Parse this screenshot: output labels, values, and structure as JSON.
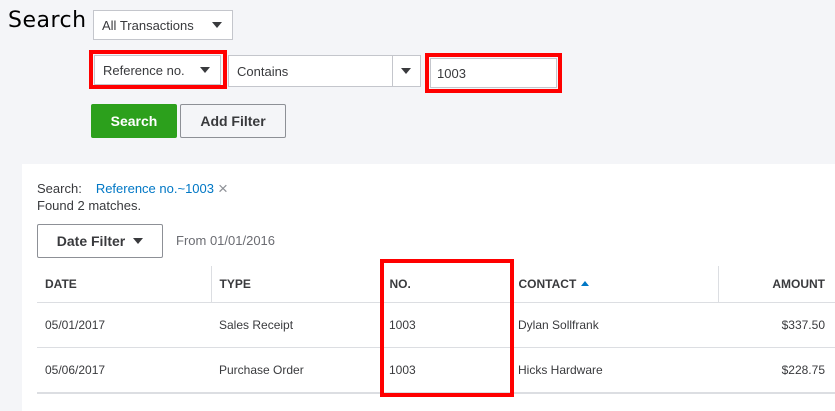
{
  "page": {
    "title": "Search"
  },
  "filters": {
    "transaction_type": "All Transactions",
    "field": "Reference no.",
    "condition": "Contains",
    "value": "1003"
  },
  "buttons": {
    "search": "Search",
    "add_filter": "Add Filter",
    "date_filter": "Date Filter"
  },
  "results": {
    "search_label": "Search:",
    "search_chip": "Reference no.~1003",
    "found": "Found 2 matches.",
    "date_range": "From 01/01/2016",
    "columns": {
      "date": "DATE",
      "type": "TYPE",
      "no": "NO.",
      "contact": "CONTACT",
      "amount": "AMOUNT"
    },
    "rows": [
      {
        "date": "05/01/2017",
        "type": "Sales Receipt",
        "no": "1003",
        "contact": "Dylan Sollfrank",
        "amount": "$337.50"
      },
      {
        "date": "05/06/2017",
        "type": "Purchase Order",
        "no": "1003",
        "contact": "Hicks Hardware",
        "amount": "$228.75"
      }
    ]
  },
  "colors": {
    "primary_green": "#2ca01c",
    "link_blue": "#0077c5",
    "highlight_red": "#ff0000"
  },
  "icons": {
    "sort": "sort-ascending-icon",
    "remove": "close-icon",
    "dropdown": "chevron-down-icon"
  }
}
